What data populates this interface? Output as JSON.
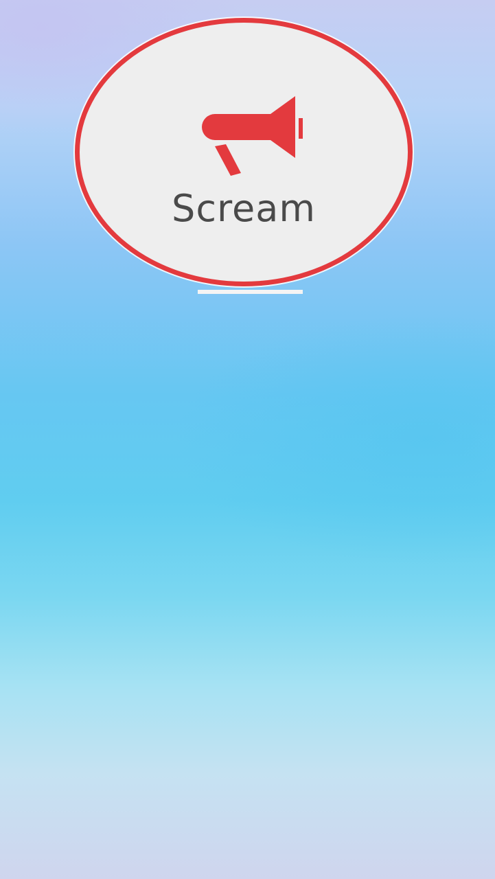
{
  "action_button": {
    "label": "Scream",
    "icon": "megaphone-icon",
    "accent_color": "#e33a3e",
    "label_color": "#4a4a4a",
    "fill_color": "#eeeeee"
  }
}
